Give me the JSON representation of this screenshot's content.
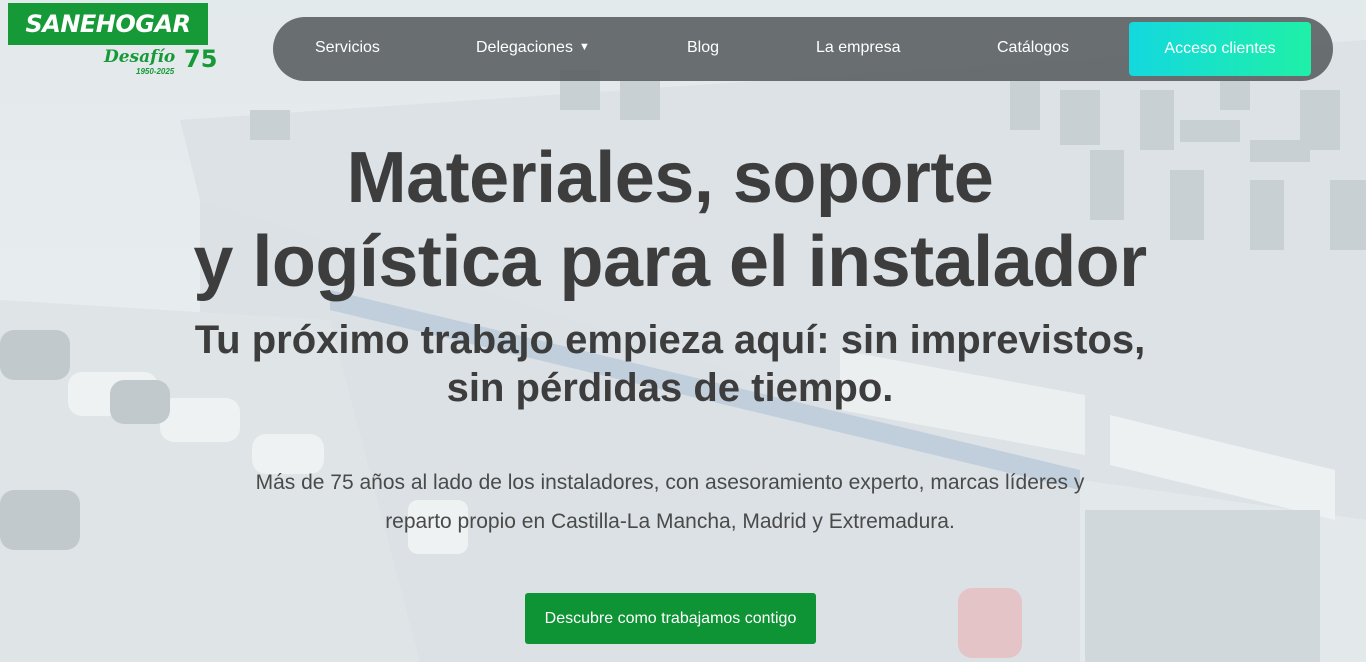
{
  "logo": {
    "brand": "SANEHOGAR",
    "tagline": "Desafío",
    "anniversary": "75",
    "years": "1950-2025"
  },
  "nav": {
    "items": [
      {
        "label": "Servicios"
      },
      {
        "label": "Delegaciones"
      },
      {
        "label": "Blog"
      },
      {
        "label": "La empresa"
      },
      {
        "label": "Catálogos"
      }
    ],
    "cta": "Acceso clientes"
  },
  "hero": {
    "title_line1": "Materiales, soporte",
    "title_line2": "y logística para el instalador",
    "subtitle_line1": "Tu próximo trabajo empieza aquí: sin imprevistos,",
    "subtitle_line2": "sin pérdidas de tiempo.",
    "desc_line1": "Más de 75 años al lado de los instaladores, con asesoramiento experto, marcas líderes y",
    "desc_line2": "reparto propio en Castilla-La Mancha, Madrid y Extremadura.",
    "button": "Descubre como trabajamos contigo"
  },
  "colors": {
    "brand_green": "#169a37",
    "cta_gradient_start": "#14d8df",
    "cta_gradient_end": "#1ff0a7",
    "button_green": "#0e9435",
    "nav_bg": "#585c5e"
  }
}
